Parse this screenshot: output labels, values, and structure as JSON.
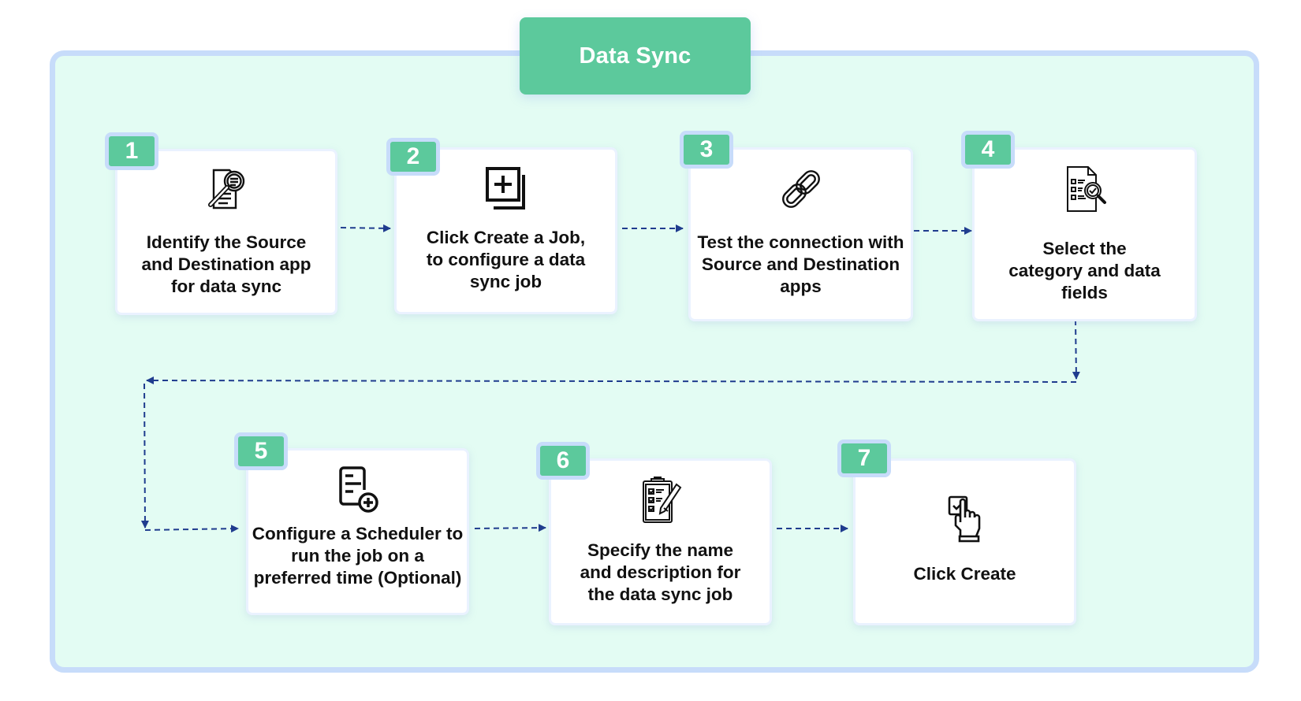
{
  "title": "Data Sync",
  "colors": {
    "accent_green": "#5cc99c",
    "border_blue": "#c7dcfa",
    "panel_background": "#e3fcf3",
    "arrow_navy": "#1f3c8e",
    "text_dark": "#111111"
  },
  "steps": [
    {
      "number": "1",
      "label": "Identify the Source and Destination app for data sync",
      "icon": "document-search-icon"
    },
    {
      "number": "2",
      "label": "Click Create a Job, to configure a data sync job",
      "icon": "add-copy-icon"
    },
    {
      "number": "3",
      "label": "Test the connection with Source and Destination apps",
      "icon": "link-chain-icon"
    },
    {
      "number": "4",
      "label": "Select the category and data fields",
      "icon": "checklist-search-icon"
    },
    {
      "number": "5",
      "label": "Configure a Scheduler to run the job on a preferred time (Optional)",
      "icon": "document-add-icon"
    },
    {
      "number": "6",
      "label": "Specify the name and description for the data sync job",
      "icon": "clipboard-pencil-icon"
    },
    {
      "number": "7",
      "label": "Click Create",
      "icon": "click-checkbox-icon"
    }
  ],
  "flow": [
    {
      "from": "1",
      "to": "2"
    },
    {
      "from": "2",
      "to": "3"
    },
    {
      "from": "3",
      "to": "4"
    },
    {
      "from": "4",
      "to": "5"
    },
    {
      "from": "5",
      "to": "6"
    },
    {
      "from": "6",
      "to": "7"
    }
  ]
}
